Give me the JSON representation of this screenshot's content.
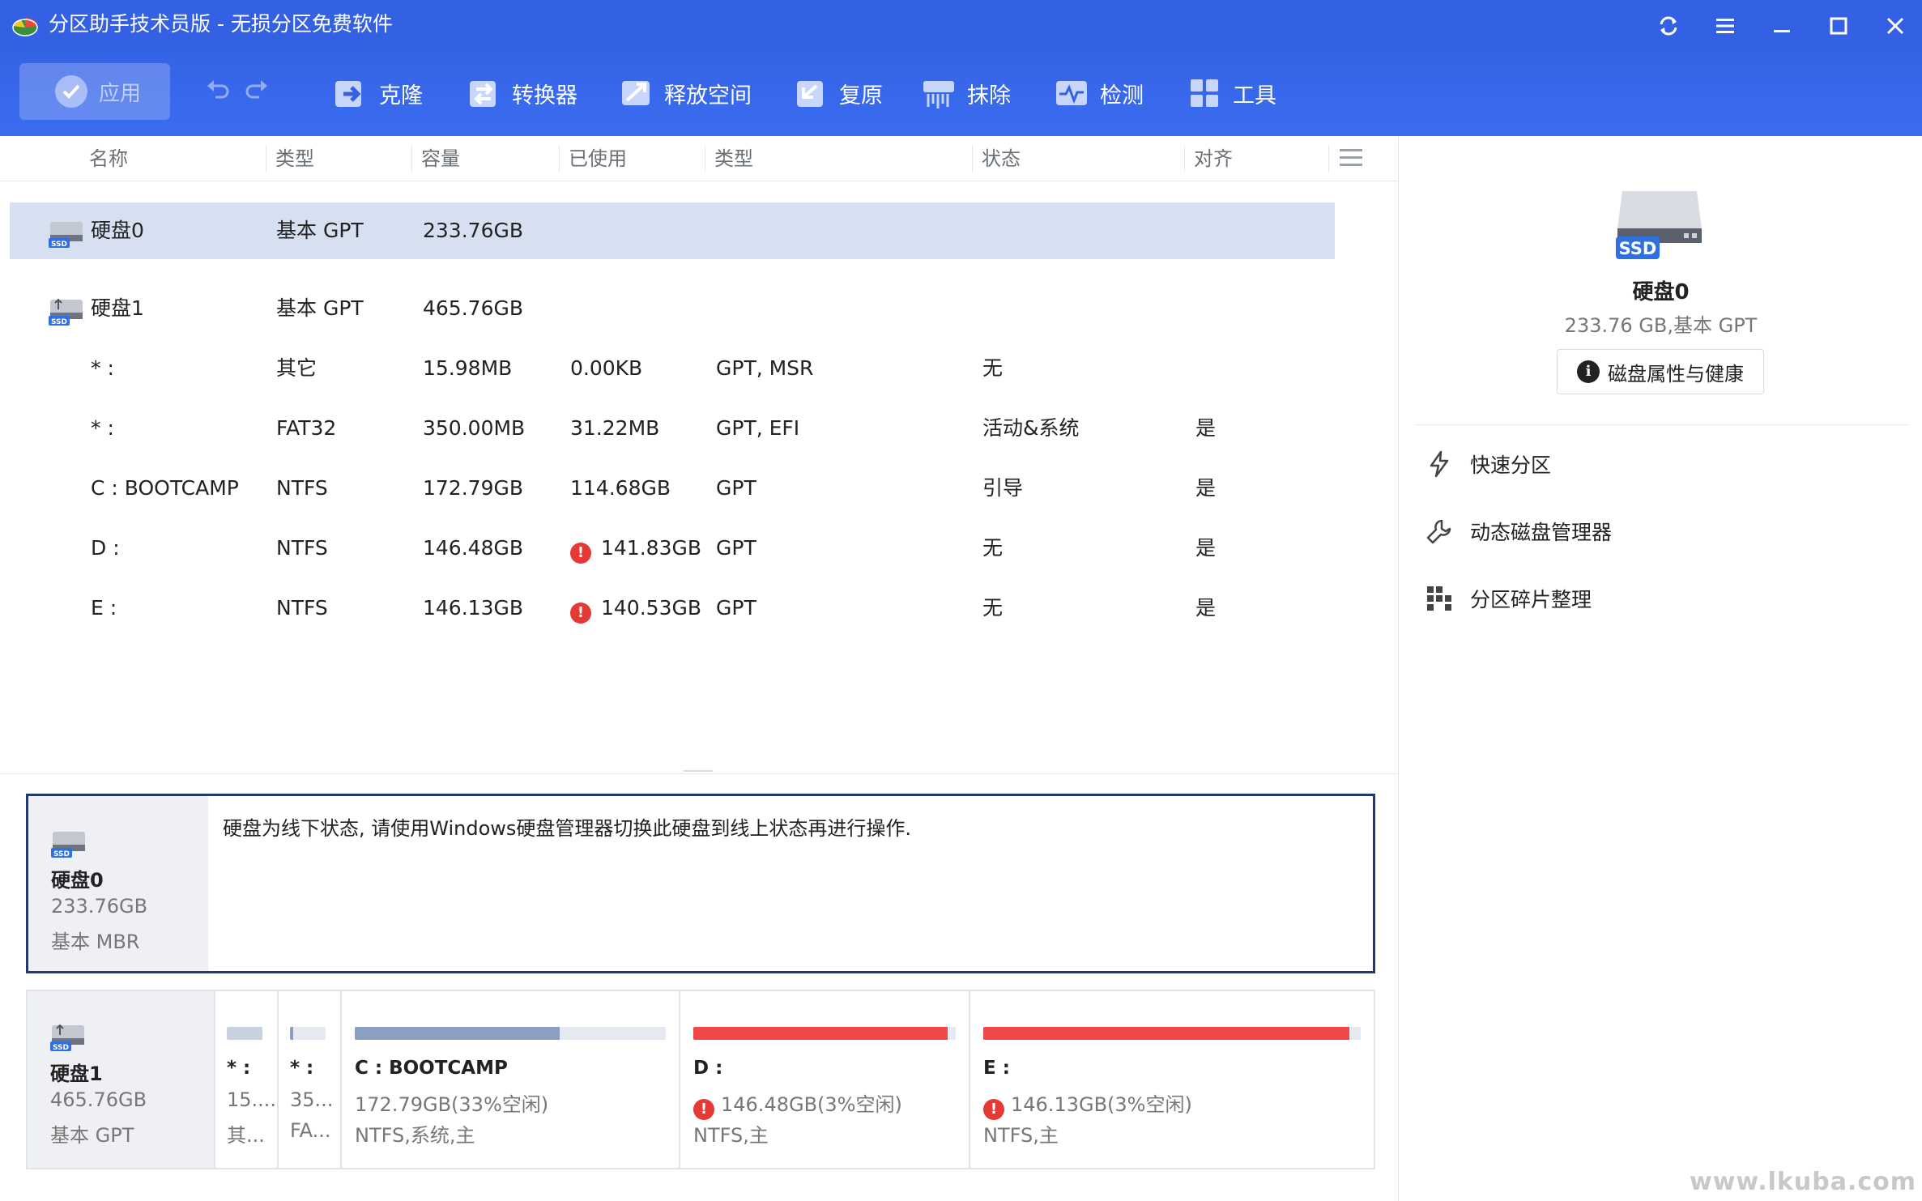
{
  "window": {
    "title": "分区助手技术员版 - 无损分区免费软件",
    "controls": [
      "refresh-icon",
      "menu-icon",
      "minimize-icon",
      "maximize-icon",
      "close-icon"
    ]
  },
  "toolbar": {
    "apply_label": "应用",
    "items": [
      {
        "label": "克隆",
        "icon": "clone-icon"
      },
      {
        "label": "转换器",
        "icon": "convert-icon"
      },
      {
        "label": "释放空间",
        "icon": "free-space-icon"
      },
      {
        "label": "复原",
        "icon": "restore-icon"
      },
      {
        "label": "抹除",
        "icon": "wipe-icon"
      },
      {
        "label": "检测",
        "icon": "check-icon"
      },
      {
        "label": "工具",
        "icon": "tools-icon"
      }
    ]
  },
  "table": {
    "headers": [
      "名称",
      "类型",
      "容量",
      "已使用",
      "类型",
      "状态",
      "对齐"
    ],
    "rows": [
      {
        "kind": "disk",
        "name": "硬盘0",
        "type": "基本 GPT",
        "capacity": "233.76GB",
        "used": "",
        "fs": "",
        "status": "",
        "align": "",
        "selected": true
      },
      {
        "kind": "disk",
        "name": "硬盘1",
        "type": "基本 GPT",
        "capacity": "465.76GB",
        "used": "",
        "fs": "",
        "status": "",
        "align": ""
      },
      {
        "kind": "part",
        "name": "* :",
        "type": "其它",
        "capacity": "15.98MB",
        "used": "0.00KB",
        "fs": "GPT, MSR",
        "status": "无",
        "align": ""
      },
      {
        "kind": "part",
        "name": "* :",
        "type": "FAT32",
        "capacity": "350.00MB",
        "used": "31.22MB",
        "fs": "GPT, EFI",
        "status": "活动&系统",
        "align": "是"
      },
      {
        "kind": "part",
        "name": "C : BOOTCAMP",
        "type": "NTFS",
        "capacity": "172.79GB",
        "used": "114.68GB",
        "fs": "GPT",
        "status": "引导",
        "align": "是"
      },
      {
        "kind": "part",
        "name": "D :",
        "type": "NTFS",
        "capacity": "146.48GB",
        "used": "141.83GB",
        "warn": true,
        "fs": "GPT",
        "status": "无",
        "align": "是"
      },
      {
        "kind": "part",
        "name": "E :",
        "type": "NTFS",
        "capacity": "146.13GB",
        "used": "140.53GB",
        "warn": true,
        "fs": "GPT",
        "status": "无",
        "align": "是"
      }
    ]
  },
  "right_panel": {
    "disk_name": "硬盘0",
    "disk_info": "233.76 GB,基本 GPT",
    "props_button": "磁盘属性与健康",
    "ssd_badge": "SSD",
    "links": [
      {
        "label": "快速分区",
        "icon": "lightning-icon"
      },
      {
        "label": "动态磁盘管理器",
        "icon": "wrench-icon"
      },
      {
        "label": "分区碎片整理",
        "icon": "defrag-icon"
      }
    ]
  },
  "disk_map": {
    "disk0": {
      "name": "硬盘0",
      "size": "233.76GB",
      "type": "基本 MBR",
      "message": "硬盘为线下状态, 请使用Windows硬盘管理器切换此硬盘到线上状态再进行操作."
    },
    "disk1": {
      "name": "硬盘1",
      "size": "465.76GB",
      "type": "基本 GPT",
      "partitions": [
        {
          "name": "* :",
          "size": "15....",
          "type": "其...",
          "used_fraction": 0.0,
          "color": "#c8d1e0"
        },
        {
          "name": "* :",
          "size": "35...",
          "type": "FA...",
          "used_fraction": 0.09,
          "color": "#8c9fc0"
        },
        {
          "name": "C : BOOTCAMP",
          "size": "172.79GB(33%空闲)",
          "type": "NTFS,系统,主",
          "used_fraction": 0.66,
          "color": "#8c9fc0"
        },
        {
          "name": "D :",
          "size": "146.48GB(3%空闲)",
          "type": "NTFS,主",
          "used_fraction": 0.97,
          "color": "#f04848",
          "warn": true
        },
        {
          "name": "E :",
          "size": "146.13GB(3%空闲)",
          "type": "NTFS,主",
          "used_fraction": 0.97,
          "color": "#f04848",
          "warn": true
        }
      ]
    }
  },
  "watermark": "www.lkuba.com"
}
